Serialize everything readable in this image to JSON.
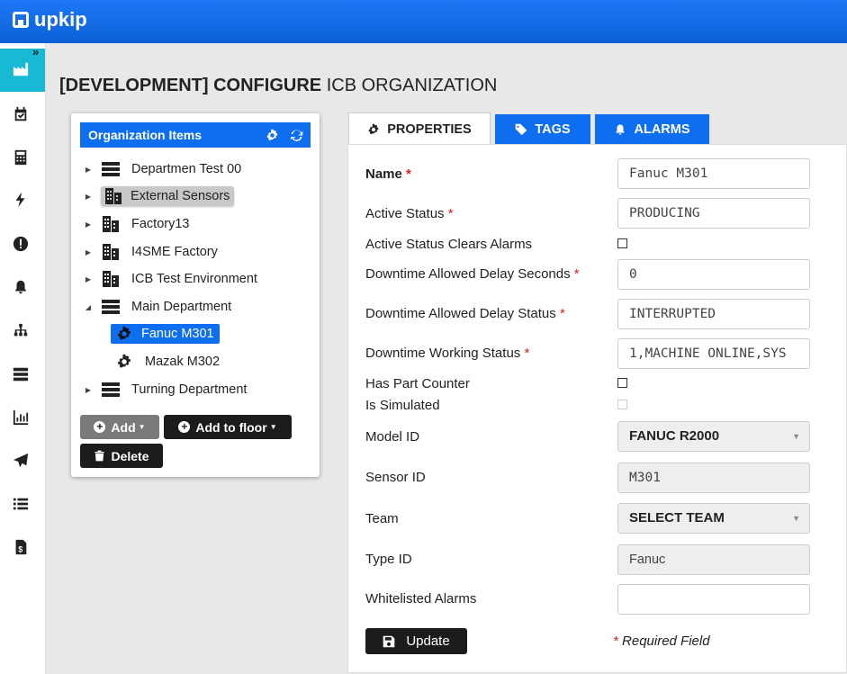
{
  "app": {
    "logo_text": "upkip"
  },
  "page": {
    "title_prefix": "[DEVELOPMENT] CONFIGURE",
    "title_suffix": "ICB ORGANIZATION"
  },
  "sidebar": {
    "items": [
      {
        "icon": "factory-icon",
        "active": true
      },
      {
        "icon": "calendar-check-icon"
      },
      {
        "icon": "calculator-icon"
      },
      {
        "icon": "bolt-icon"
      },
      {
        "icon": "exclamation-circle-icon"
      },
      {
        "icon": "bell-icon"
      },
      {
        "icon": "sitemap-icon"
      },
      {
        "icon": "server-icon"
      },
      {
        "icon": "bar-chart-icon"
      },
      {
        "icon": "paper-plane-icon"
      },
      {
        "icon": "list-icon"
      },
      {
        "icon": "invoice-icon"
      }
    ]
  },
  "org_panel": {
    "title": "Organization Items",
    "tree": [
      {
        "label": "Departmen Test 00",
        "icon": "server-icon",
        "state": "collapsed"
      },
      {
        "label": "External Sensors",
        "icon": "building-icon",
        "state": "collapsed",
        "highlighted": true
      },
      {
        "label": "Factory13",
        "icon": "building-icon",
        "state": "collapsed"
      },
      {
        "label": "I4SME Factory",
        "icon": "building-icon",
        "state": "collapsed"
      },
      {
        "label": "ICB Test Environment",
        "icon": "building-icon",
        "state": "collapsed"
      },
      {
        "label": "Main Department",
        "icon": "server-icon",
        "state": "expanded"
      },
      {
        "label": "Fanuc M301",
        "icon": "gear-icon",
        "selected": true
      },
      {
        "label": "Mazak M302",
        "icon": "gear-icon"
      },
      {
        "label": "Turning Department",
        "icon": "server-icon",
        "state": "collapsed"
      }
    ],
    "buttons": {
      "add": "Add",
      "add_to_floor": "Add to floor",
      "delete": "Delete"
    }
  },
  "tabs": [
    {
      "label": "PROPERTIES",
      "icon": "gear-icon",
      "active": true
    },
    {
      "label": "TAGS",
      "icon": "tag-icon"
    },
    {
      "label": "ALARMS",
      "icon": "bell-icon"
    }
  ],
  "properties": {
    "name": {
      "label": "Name",
      "value": "Fanuc M301"
    },
    "active_status": {
      "label": "Active Status",
      "value": "PRODUCING"
    },
    "active_status_clears_alarms": {
      "label": "Active Status Clears Alarms",
      "checked": false
    },
    "downtime_delay_seconds": {
      "label": "Downtime Allowed Delay Seconds",
      "value": "0"
    },
    "downtime_delay_status": {
      "label": "Downtime Allowed Delay Status",
      "value": "INTERRUPTED"
    },
    "downtime_working_status": {
      "label": "Downtime Working Status",
      "value": "1,MACHINE ONLINE,SYS"
    },
    "has_part_counter": {
      "label": "Has Part Counter",
      "checked": false
    },
    "is_simulated": {
      "label": "Is Simulated",
      "checked": false
    },
    "model_id": {
      "label": "Model ID",
      "value": "FANUC R2000"
    },
    "sensor_id": {
      "label": "Sensor ID",
      "value": "M301"
    },
    "team": {
      "label": "Team",
      "value": "SELECT TEAM"
    },
    "type_id": {
      "label": "Type ID",
      "value": "Fanuc"
    },
    "whitelisted_alarms": {
      "label": "Whitelisted Alarms",
      "value": ""
    },
    "required_marker": "*",
    "update_label": "Update",
    "required_note": "Required Field"
  },
  "colors": {
    "brand_blue": "#0d6ef0",
    "accent_cyan": "#17b9d4",
    "required_red": "#e02020",
    "dark_button": "#1c1c1c"
  }
}
